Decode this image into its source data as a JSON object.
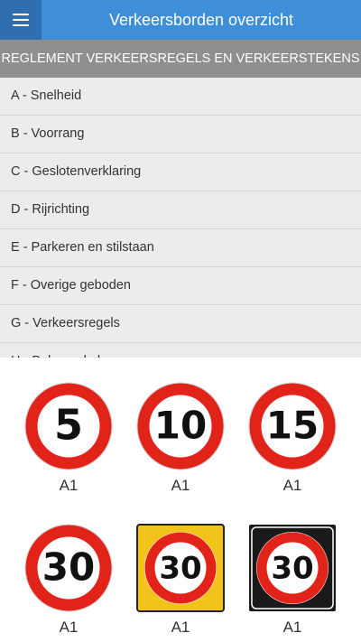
{
  "header": {
    "title": "Verkeersborden overzicht",
    "menu_icon": "hamburger-menu-icon"
  },
  "section": {
    "title": "REGLEMENT VERKEERSREGELS EN VERKEERSTEKENS"
  },
  "categories": [
    {
      "label": "A - Snelheid"
    },
    {
      "label": "B - Voorrang"
    },
    {
      "label": "C - Geslotenverklaring"
    },
    {
      "label": "D - Rijrichting"
    },
    {
      "label": "E - Parkeren en stilstaan"
    },
    {
      "label": "F - Overige geboden"
    },
    {
      "label": "G - Verkeersregels"
    },
    {
      "label": "H - Bebouwde kom"
    }
  ],
  "signs": [
    {
      "number": "5",
      "code": "A1",
      "style": "plain"
    },
    {
      "number": "10",
      "code": "A1",
      "style": "plain"
    },
    {
      "number": "15",
      "code": "A1",
      "style": "plain"
    },
    {
      "number": "30",
      "code": "A1",
      "style": "plain"
    },
    {
      "number": "30",
      "code": "A1",
      "style": "yellow-plate"
    },
    {
      "number": "30",
      "code": "A1",
      "style": "black-plate"
    }
  ],
  "colors": {
    "appbar": "#3f8ed8",
    "menu": "#2f6fb0",
    "section_header": "#8f8f8f",
    "sign_red": "#e2231a",
    "plate_yellow": "#f2c318",
    "plate_black": "#1a1a1a"
  }
}
